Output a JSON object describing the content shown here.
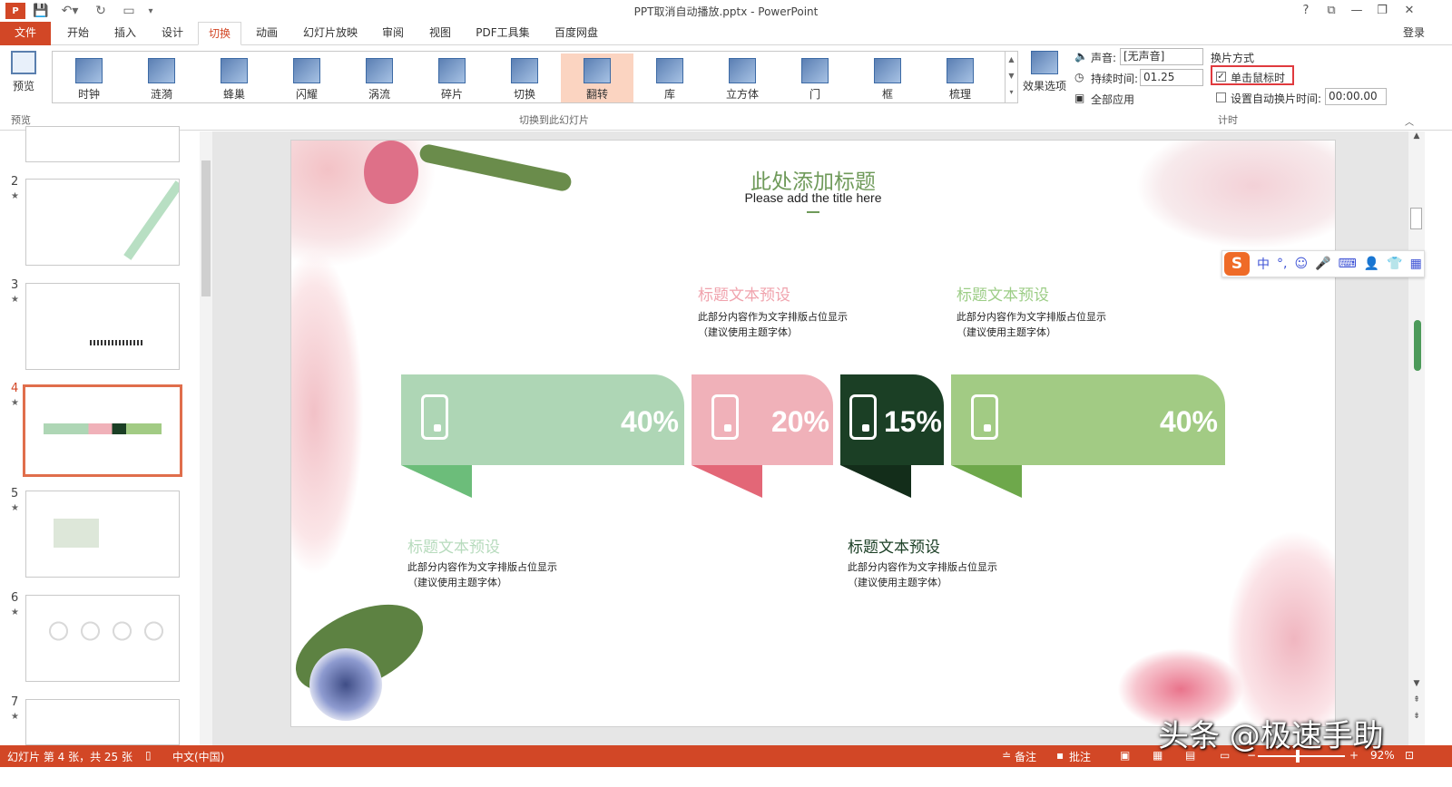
{
  "window": {
    "title": "PPT取消自动播放.pptx - PowerPoint",
    "help": "?",
    "login": "登录"
  },
  "tabs": [
    {
      "label": "文件"
    },
    {
      "label": "开始"
    },
    {
      "label": "插入"
    },
    {
      "label": "设计"
    },
    {
      "label": "切换"
    },
    {
      "label": "动画"
    },
    {
      "label": "幻灯片放映"
    },
    {
      "label": "审阅"
    },
    {
      "label": "视图"
    },
    {
      "label": "PDF工具集"
    },
    {
      "label": "百度网盘"
    }
  ],
  "ribbon": {
    "preview_label": "预览",
    "preview_group": "预览",
    "transitions": [
      {
        "label": "时钟"
      },
      {
        "label": "涟漪"
      },
      {
        "label": "蜂巢"
      },
      {
        "label": "闪耀"
      },
      {
        "label": "涡流"
      },
      {
        "label": "碎片"
      },
      {
        "label": "切换"
      },
      {
        "label": "翻转"
      },
      {
        "label": "库"
      },
      {
        "label": "立方体"
      },
      {
        "label": "门"
      },
      {
        "label": "框"
      },
      {
        "label": "梳理"
      }
    ],
    "selected_transition": "翻转",
    "effect_options": "效果选项",
    "transition_group": "切换到此幻灯片",
    "sound_label": "声音:",
    "sound_value": "[无声音]",
    "duration_label": "持续时间:",
    "duration_value": "01.25",
    "apply_all": "全部应用",
    "advance_title": "换片方式",
    "on_click_label": "单击鼠标时",
    "on_click_checked": true,
    "auto_label": "设置自动换片时间:",
    "auto_value": "00:00.00",
    "auto_checked": false,
    "timing_group": "计时"
  },
  "slides_panel": [
    {
      "num": "",
      "star": false
    },
    {
      "num": "2",
      "star": true
    },
    {
      "num": "3",
      "star": true
    },
    {
      "num": "4",
      "star": true,
      "selected": true
    },
    {
      "num": "5",
      "star": true
    },
    {
      "num": "6",
      "star": true
    },
    {
      "num": "7",
      "star": true
    }
  ],
  "slide": {
    "title": "此处添加标题",
    "subtitle": "Please add the title here",
    "cards": [
      {
        "pct": "40%",
        "color": "#aed6b5",
        "tab": "#6cbd7a"
      },
      {
        "pct": "20%",
        "color": "#f0b1b9",
        "tab": "#e36777"
      },
      {
        "pct": "15%",
        "color": "#1b3f25",
        "tab": "#132d1a"
      },
      {
        "pct": "40%",
        "color": "#a2cb84",
        "tab": "#6ea84b"
      }
    ],
    "sections": [
      {
        "title": "标题文本预设",
        "body1": "此部分内容作为文字排版占位显示",
        "body2": "（建议使用主题字体）",
        "color": "#f0a3ad"
      },
      {
        "title": "标题文本预设",
        "body1": "此部分内容作为文字排版占位显示",
        "body2": "（建议使用主题字体）",
        "color": "#9ccd86"
      },
      {
        "title": "标题文本预设",
        "body1": "此部分内容作为文字排版占位显示",
        "body2": "（建议使用主题字体）",
        "color": "#b7dbbd"
      },
      {
        "title": "标题文本预设",
        "body1": "此部分内容作为文字排版占位显示",
        "body2": "（建议使用主题字体）",
        "color": "#1b3f25"
      }
    ]
  },
  "ime": {
    "label": "中"
  },
  "status": {
    "slide_info": "幻灯片 第 4 张，共 25 张",
    "language": "中文(中国)",
    "notes": "备注",
    "comments": "批注",
    "zoom": "92%"
  },
  "watermark": "头条 @极速手助",
  "colors": {
    "accent": "#d24726"
  }
}
